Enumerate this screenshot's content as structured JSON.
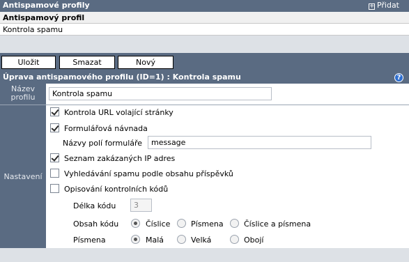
{
  "list_panel": {
    "title": "Antispamové profily",
    "add_label": "Přidat",
    "column_header": "Antispamový profil",
    "rows": [
      "Kontrola spamu"
    ]
  },
  "toolbar": {
    "save": "Uložit",
    "delete": "Smazat",
    "new": "Nový"
  },
  "form": {
    "title": "Úprava antispamového profilu (ID=1) : Kontrola spamu",
    "help_glyph": "?",
    "profile_name_label": "Název profilu",
    "profile_name_value": "Kontrola spamu",
    "settings_label": "Nastavení",
    "check_url": {
      "label": "Kontrola URL volající stránky",
      "checked": true
    },
    "form_decoy": {
      "label": "Formulářová návnada",
      "checked": true
    },
    "field_names_label": "Názvy polí formuláře",
    "field_names_value": "message",
    "ip_blacklist": {
      "label": "Seznam zakázaných IP adres",
      "checked": true
    },
    "content_search": {
      "label": "Vyhledávání spamu podle obsahu příspěvků",
      "checked": false
    },
    "captcha": {
      "label": "Opisování kontrolních kódů",
      "checked": false
    },
    "code_length_label": "Délka kódu",
    "code_length_value": "3",
    "code_content_label": "Obsah kódu",
    "code_content_options": [
      "Číslice",
      "Písmena",
      "Číslice a písmena"
    ],
    "code_content_selected": 0,
    "letters_label": "Písmena",
    "letters_options": [
      "Malá",
      "Velká",
      "Obojí"
    ],
    "letters_selected": 0
  },
  "colors": {
    "header_bg": "#5a6b82",
    "panel_bg": "#dde1e6",
    "help_icon": "#2f6fd0"
  }
}
